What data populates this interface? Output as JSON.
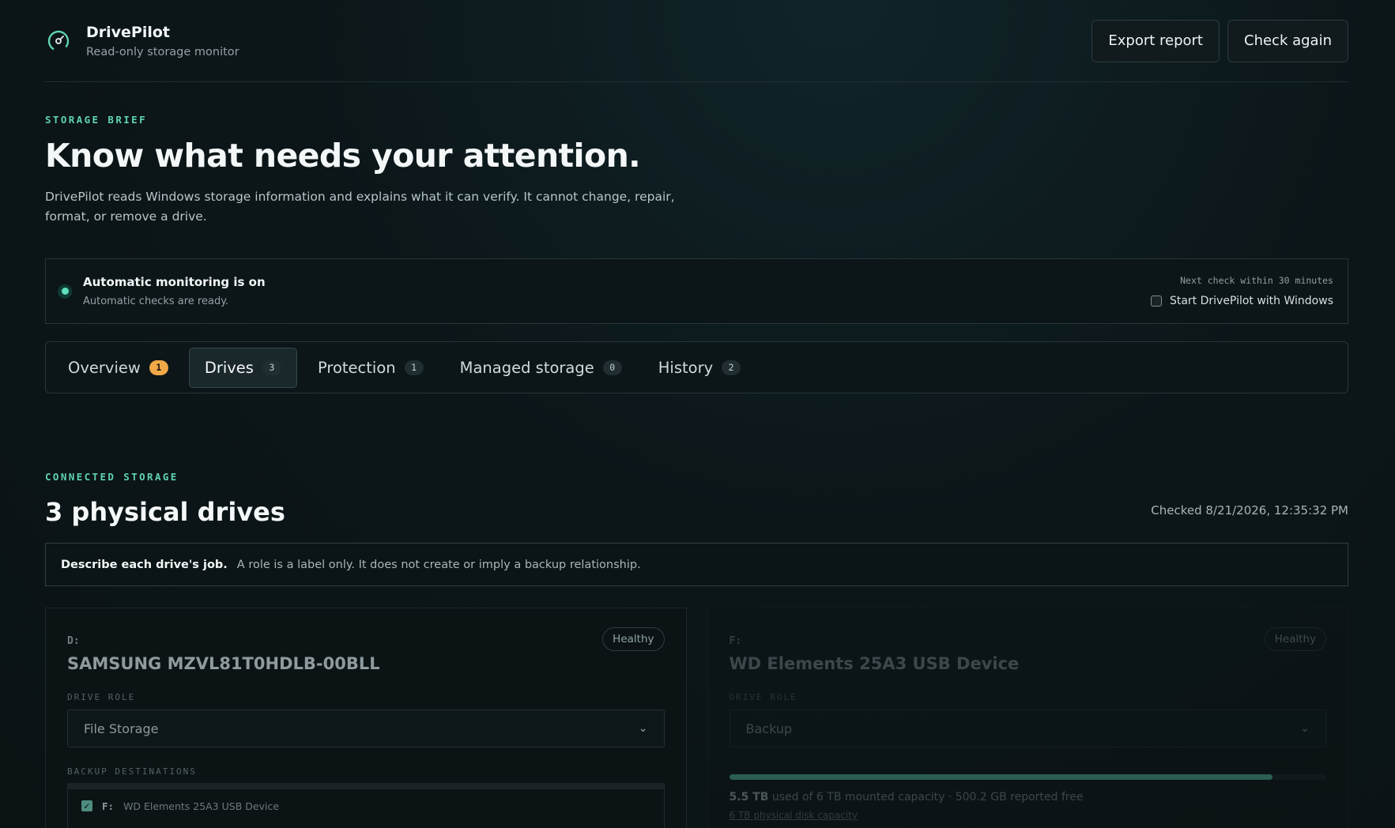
{
  "app": {
    "name": "DrivePilot",
    "subtitle": "Read-only storage monitor"
  },
  "header": {
    "export_label": "Export report",
    "check_label": "Check again"
  },
  "hero": {
    "eyebrow": "STORAGE BRIEF",
    "title": "Know what needs your attention.",
    "description": "DrivePilot reads Windows storage information and explains what it can verify. It cannot change, repair, format, or remove a drive."
  },
  "monitor": {
    "title": "Automatic monitoring is on",
    "subtitle": "Automatic checks are ready.",
    "next_check": "Next check within 30 minutes",
    "startup_label": "Start DrivePilot with Windows",
    "startup_checked": false
  },
  "tabs": [
    {
      "label": "Overview",
      "count": "1",
      "active": false,
      "warn": true
    },
    {
      "label": "Drives",
      "count": "3",
      "active": true,
      "warn": false
    },
    {
      "label": "Protection",
      "count": "1",
      "active": false,
      "warn": false
    },
    {
      "label": "Managed storage",
      "count": "0",
      "active": false,
      "warn": false
    },
    {
      "label": "History",
      "count": "2",
      "active": false,
      "warn": false
    }
  ],
  "storage": {
    "eyebrow": "CONNECTED STORAGE",
    "title": "3 physical drives",
    "checked": "Checked 8/21/2026, 12:35:32 PM",
    "note_bold": "Describe each drive's job.",
    "note_text": "A role is a label only. It does not create or imply a backup relationship."
  },
  "drives": [
    {
      "letter": "D:",
      "name": "SAMSUNG MZVL81T0HDLB-00BLL",
      "health": "Healthy",
      "role_label": "DRIVE ROLE",
      "role": "File Storage",
      "dest_label": "BACKUP DESTINATIONS",
      "dest_letter": "F:",
      "dest_name": "WD Elements 25A3 USB Device"
    },
    {
      "letter": "F:",
      "name": "WD Elements 25A3 USB Device",
      "health": "Healthy",
      "role_label": "DRIVE ROLE",
      "role": "Backup",
      "used_fraction": 0.91,
      "used": "5.5 TB",
      "usage_text": "used of 6 TB mounted capacity · 500.2 GB reported free",
      "usage_sub": "6 TB physical disk capacity"
    }
  ],
  "colors": {
    "accent": "#5fd3b4",
    "warn": "#f0a848",
    "background": "#0c1619"
  },
  "icons": {
    "logo": "gauge-icon",
    "select": "chevron-down-icon",
    "checked": "check-icon"
  }
}
